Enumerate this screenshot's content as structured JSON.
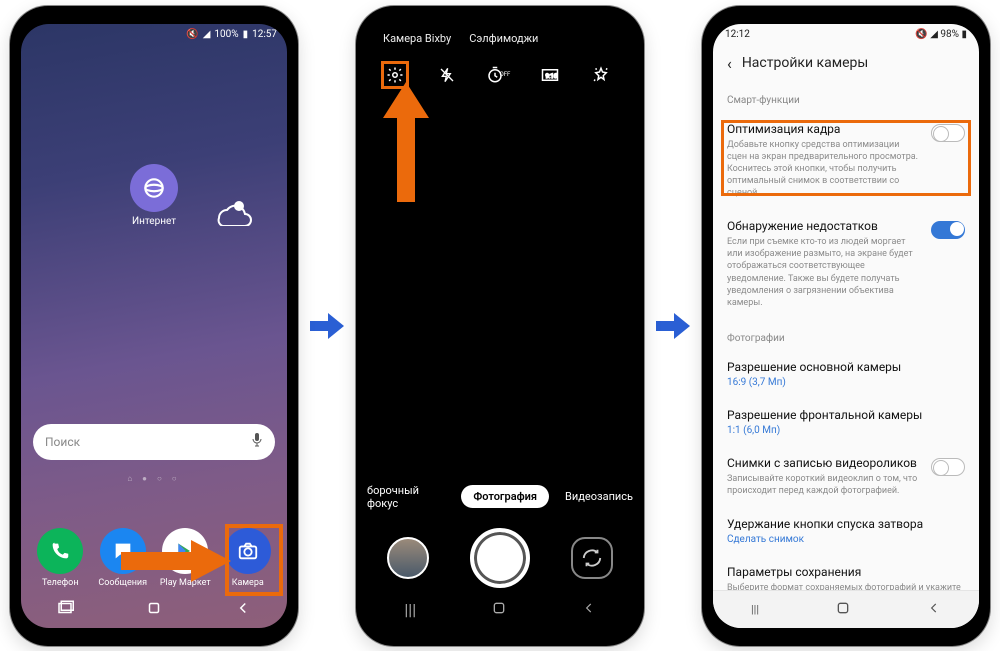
{
  "phone1": {
    "status": {
      "mute_icon": "🔇",
      "signal_icon": "📶",
      "battery": "100%",
      "time": "12:57"
    },
    "internet": {
      "label": "Интернет"
    },
    "search": {
      "placeholder": "Поиск"
    },
    "dock": {
      "phone": "Телефон",
      "messages": "Сообщения",
      "play": "Play Маркет",
      "camera": "Камера"
    }
  },
  "phone2": {
    "tabs": {
      "bixby": "Камера Bixby",
      "aremoji": "Сэлфимоджи"
    },
    "modes": {
      "focus": "борочный фокус",
      "photo": "Фотография",
      "video": "Видеозапись"
    }
  },
  "phone3": {
    "status": {
      "time": "12:12",
      "mute_icon": "🔇",
      "signal_icon": "📶",
      "battery": "98%"
    },
    "header": "Настройки камеры",
    "section_smart": "Смарт-функции",
    "opt": {
      "title": "Оптимизация кадра",
      "desc": "Добавьте кнопку средства оптимизации сцен на экран предварительного просмотра. Коснитесь этой кнопки, чтобы получить оптимальный снимок в соответствии со сценой."
    },
    "flaw": {
      "title": "Обнаружение недостатков",
      "desc": "Если при съемке кто-то из людей моргает или изображение размыто, на экране будет отображаться соответствующее уведомление. Также вы будете получать уведомления о загрязнении объектива камеры."
    },
    "section_photo": "Фотографии",
    "rear": {
      "title": "Разрешение основной камеры",
      "sub": "16:9 (3,7 Мп)"
    },
    "front": {
      "title": "Разрешение фронтальной камеры",
      "sub": "1:1 (6,0 Мп)"
    },
    "motion": {
      "title": "Снимки с записью видеороликов",
      "desc": "Записывайте короткий видеоклип о том, что происходит перед каждой фотографией."
    },
    "hold": {
      "title": "Удержание кнопки спуска затвора",
      "sub": "Сделать снимок"
    },
    "save": {
      "title": "Параметры сохранения",
      "desc": "Выберите формат сохраняемых фотографий и укажите необходимость зеркального отражения селфи."
    }
  },
  "colors": {
    "highlight": "#eb6a0c",
    "arrow": "#2a5fd4"
  }
}
